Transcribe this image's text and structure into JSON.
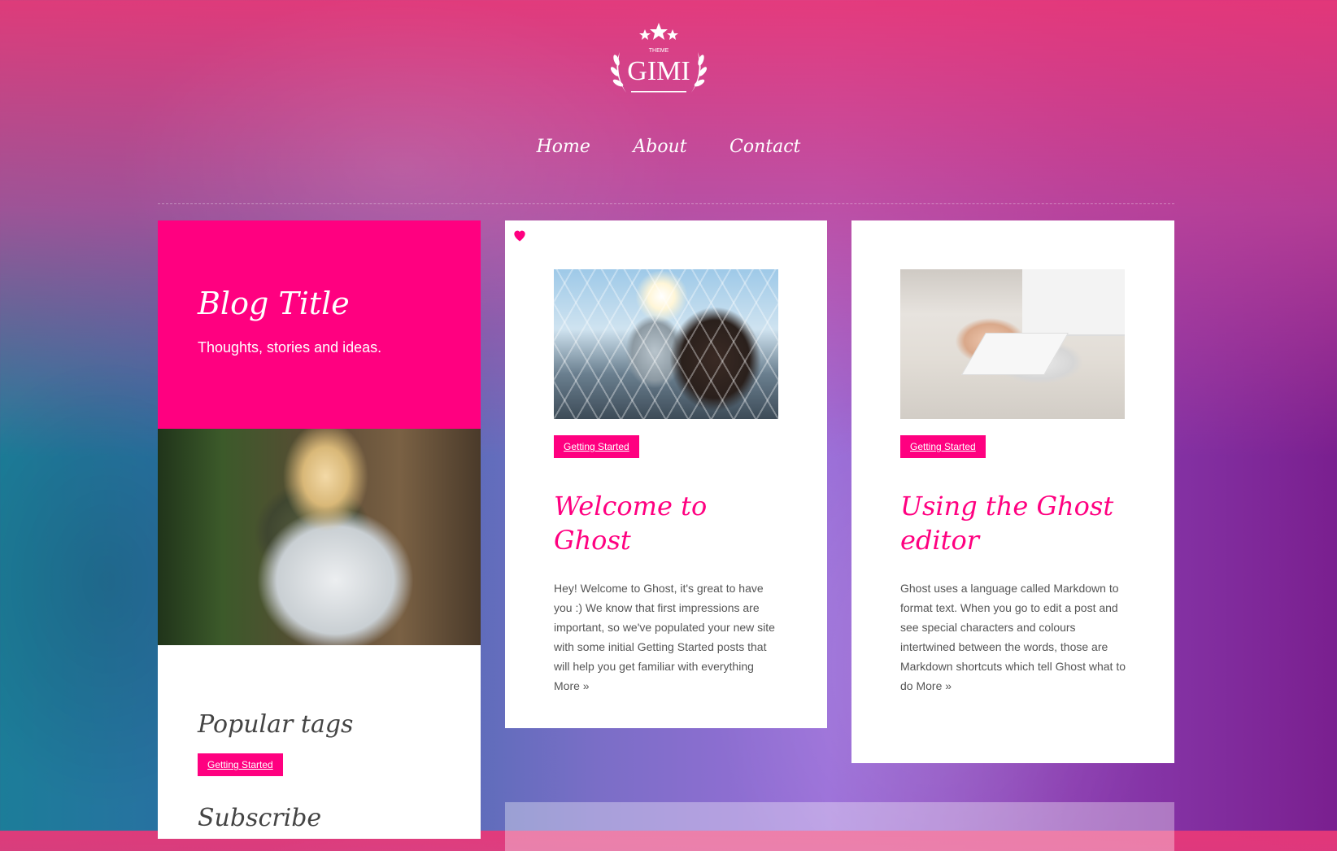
{
  "logo": {
    "small_text": "THEME",
    "name": "GIMI"
  },
  "nav": {
    "items": [
      "Home",
      "About",
      "Contact"
    ]
  },
  "sidebar": {
    "title": "Blog Title",
    "description": "Thoughts, stories and ideas.",
    "popular_tags_heading": "Popular tags",
    "tags": [
      "Getting Started"
    ],
    "subscribe_heading": "Subscribe"
  },
  "posts": [
    {
      "tag": "Getting Started",
      "title": "Welcome to Ghost",
      "excerpt": "Hey! Welcome to Ghost, it's great to have you :) We know that first impressions are important, so we've populated your new site with some initial Getting Started posts that will help you get familiar with everything",
      "more": "More »",
      "featured": true
    },
    {
      "tag": "Getting Started",
      "title": "Using the Ghost editor",
      "excerpt": "Ghost uses a language called Markdown to format text. When you go to edit a post and see special characters and colours intertwined between the words, those are Markdown shortcuts which tell Ghost what to do",
      "more": "More »",
      "featured": false
    }
  ],
  "colors": {
    "accent": "#ff0080",
    "text": "#555555"
  }
}
